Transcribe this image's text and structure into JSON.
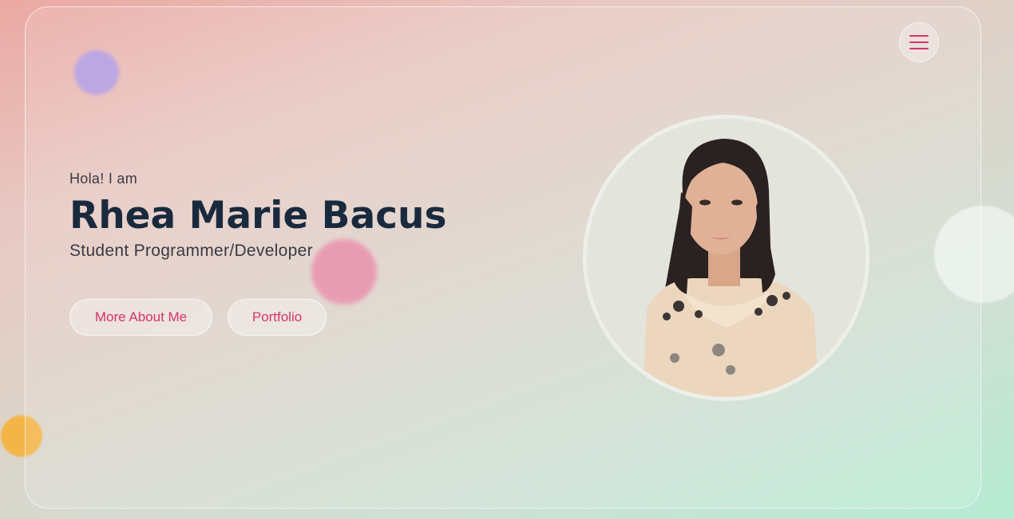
{
  "hero": {
    "greeting": "Hola! I am",
    "name": "Rhea Marie Bacus",
    "role": "Student Programmer/Developer"
  },
  "buttons": {
    "about_label": "More About Me",
    "portfolio_label": "Portfolio"
  },
  "icons": {
    "menu": "hamburger-menu-icon"
  },
  "colors": {
    "accent": "#d6336c",
    "name": "#1a2a3e"
  }
}
